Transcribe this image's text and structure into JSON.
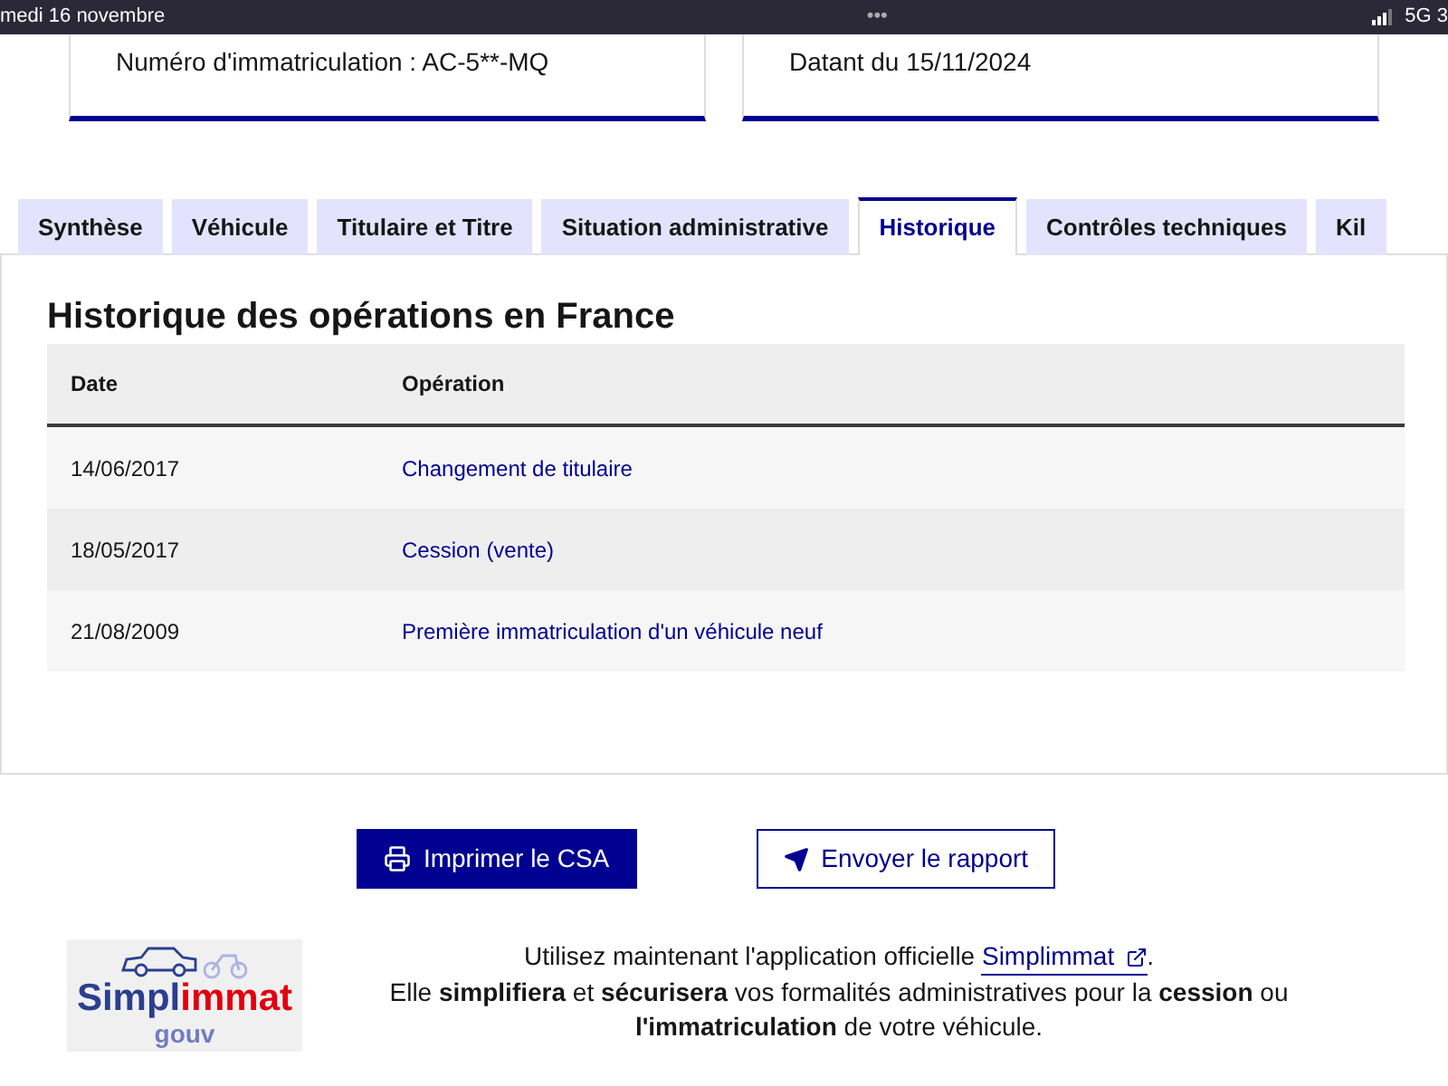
{
  "status_bar": {
    "date": "medi 16 novembre",
    "dots": "•••",
    "network": "5G 3"
  },
  "cards": [
    {
      "text": "Numéro d'immatriculation : AC-5**-MQ"
    },
    {
      "text": "Datant du 15/11/2024"
    }
  ],
  "tabs": [
    {
      "label": "Synthèse",
      "selected": false
    },
    {
      "label": "Véhicule",
      "selected": false
    },
    {
      "label": "Titulaire et Titre",
      "selected": false
    },
    {
      "label": "Situation administrative",
      "selected": false
    },
    {
      "label": "Historique",
      "selected": true
    },
    {
      "label": "Contrôles techniques",
      "selected": false
    },
    {
      "label": "Kil",
      "selected": false
    }
  ],
  "history": {
    "title": "Historique des opérations en France",
    "columns": [
      "Date",
      "Opération"
    ],
    "rows": [
      {
        "date": "14/06/2017",
        "operation": "Changement de titulaire"
      },
      {
        "date": "18/05/2017",
        "operation": "Cession (vente)"
      },
      {
        "date": "21/08/2009",
        "operation": "Première immatriculation d'un véhicule neuf"
      }
    ]
  },
  "buttons": [
    {
      "label": "Imprimer le CSA",
      "kind": "primary"
    },
    {
      "label": "Envoyer le rapport",
      "kind": "secondary"
    }
  ],
  "promo": {
    "logo_first": "Simpl",
    "logo_second": "immat",
    "logo_sub": "gouv",
    "intro": "Utilisez maintenant l'application officielle",
    "link": "Simplimmat",
    "intro_end": ".",
    "body": "Elle **simplifiera** et **sécurisera** vos formalités administratives pour la **cession** ou **l'immatriculation** de votre véhicule."
  }
}
